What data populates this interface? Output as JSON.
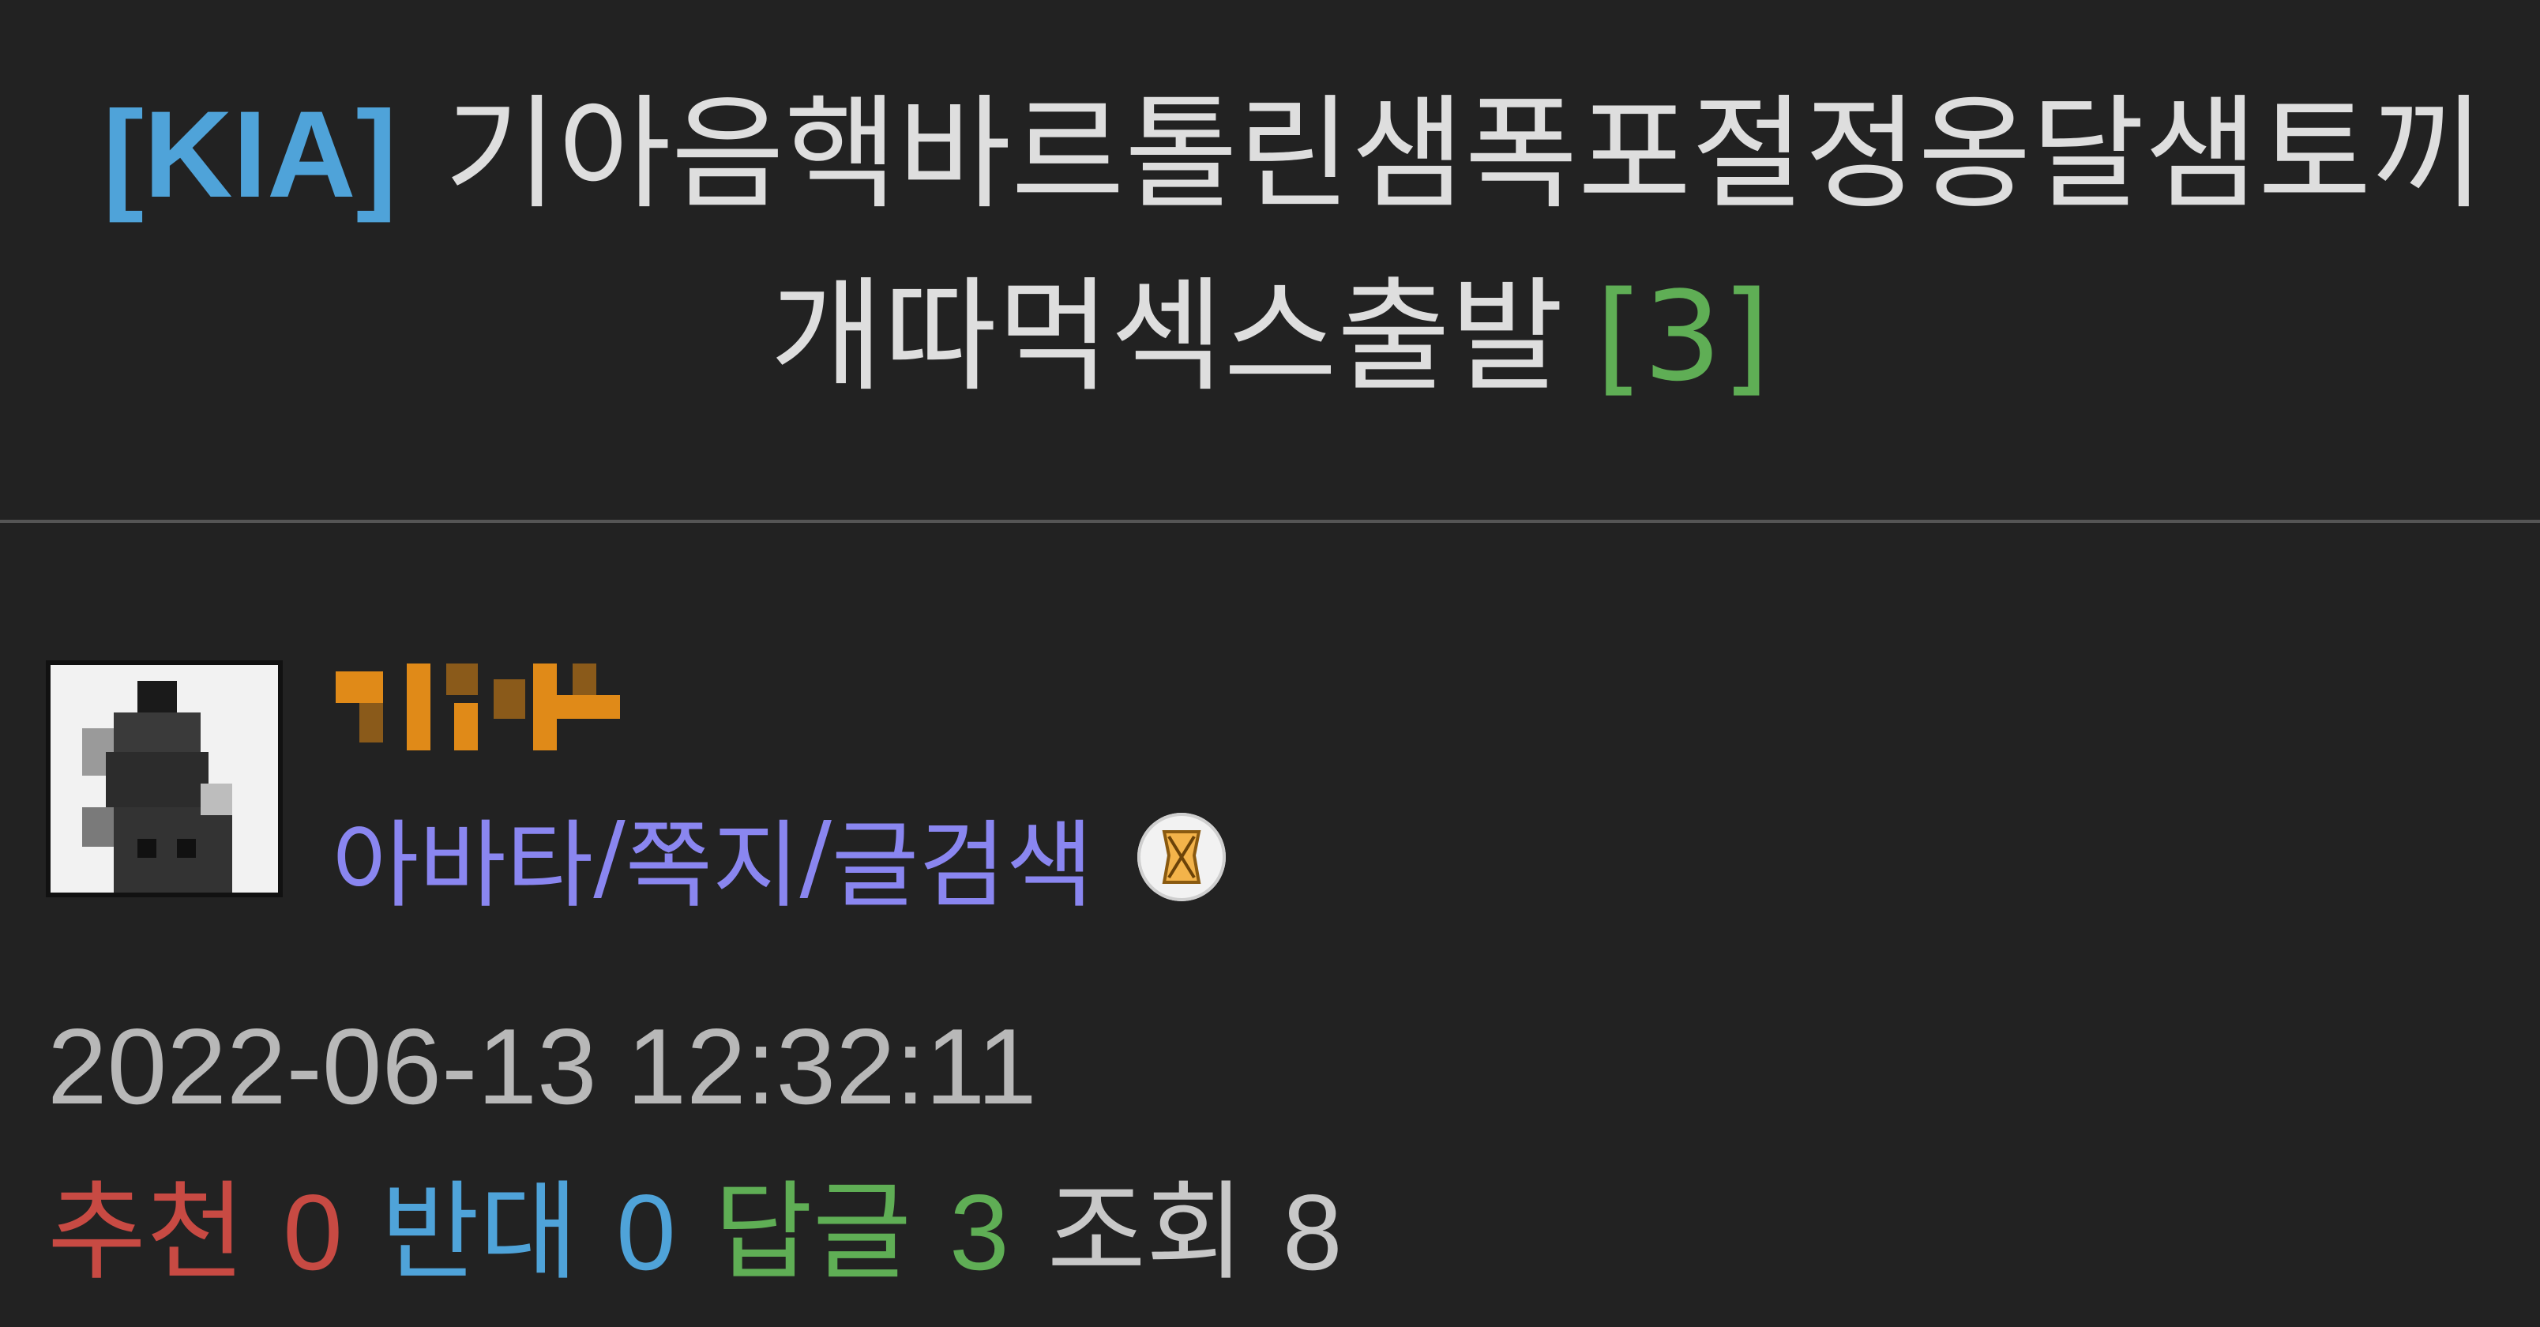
{
  "title": {
    "tag": "[KIA]",
    "line1": "기아음핵바르톨린샘폭포절정옹달샘토끼",
    "line2": "개따먹섹스출발",
    "reply_count": "[3]"
  },
  "author": {
    "links": [
      "아바타",
      "쪽지",
      "글검색"
    ],
    "separator": "/",
    "badge_icon": "level-badge-icon"
  },
  "post": {
    "datetime": "2022-06-13 12:32:11"
  },
  "stats": {
    "recommend_label": "추천",
    "recommend_value": "0",
    "oppose_label": "반대",
    "oppose_value": "0",
    "reply_label": "답글",
    "reply_value": "3",
    "view_label": "조회",
    "view_value": "8"
  },
  "colors": {
    "background": "#222222",
    "tag": "#4fa3d9",
    "reply_count": "#5fae55",
    "author_name": "#e08a18",
    "links": "#8a86f0",
    "recommend": "#c84a43",
    "oppose": "#4fa3d9",
    "reply": "#5fae55",
    "view": "#c8c8c8"
  }
}
